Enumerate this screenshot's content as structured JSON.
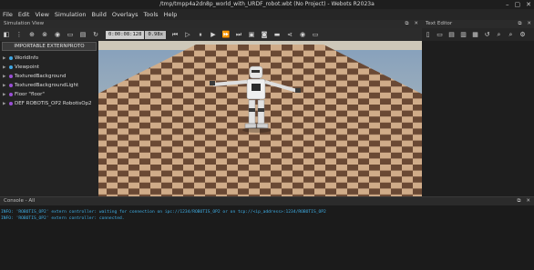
{
  "window": {
    "title": "/tmp/tmpp4a2dn8p_world_with_URDF_robot.wbt (No Project) - Webots R2023a",
    "minimize": "–",
    "maximize": "▢",
    "close": "✕"
  },
  "menu": [
    "File",
    "Edit",
    "View",
    "Simulation",
    "Build",
    "Overlays",
    "Tools",
    "Help"
  ],
  "simulation_view": {
    "title": "Simulation View",
    "time": "0:00:08:128",
    "speed": "0.98x"
  },
  "scene_tree": {
    "import_button": "IMPORTABLE EXTERNPROTO",
    "items": [
      {
        "label": "WorldInfo"
      },
      {
        "label": "Viewpoint"
      },
      {
        "label": "TexturedBackground"
      },
      {
        "label": "TexturedBackgroundLight"
      },
      {
        "label": "Floor \"floor\""
      },
      {
        "label": "DEF ROBOTIS_OP2 RobotisOp2"
      }
    ]
  },
  "text_editor": {
    "title": "Text Editor"
  },
  "console": {
    "title": "Console - All",
    "lines": [
      "INFO: 'ROBOTIS_OP2' extern controller: waiting for connection on ipc://1234/ROBOTIS_OP2 or on tcp://<ip_address>:1234/ROBOTIS_OP2",
      "INFO: 'ROBOTIS_OP2' extern controller: connected."
    ]
  },
  "colors": {
    "console_text": "#3fb0e8",
    "tree_dot": "#3fa7e4",
    "floor_light": "#d9b48f",
    "floor_dark": "#6f4c37"
  }
}
